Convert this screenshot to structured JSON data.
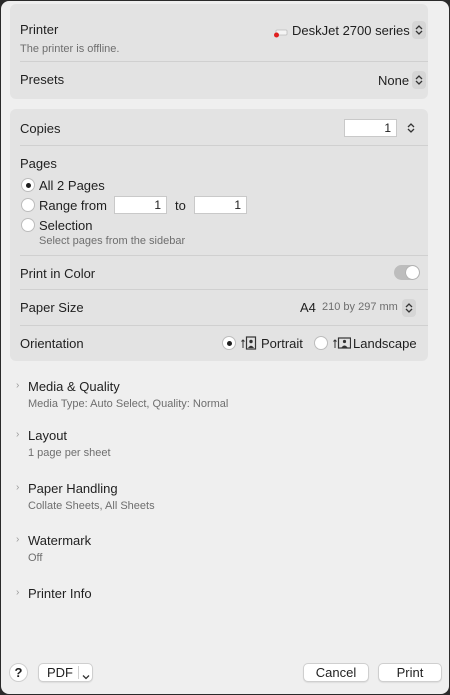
{
  "printer": {
    "label": "Printer",
    "name": "DeskJet 2700 series",
    "status": "The printer is offline."
  },
  "presets": {
    "label": "Presets",
    "value": "None"
  },
  "copies": {
    "label": "Copies",
    "value": "1"
  },
  "pages": {
    "label": "Pages",
    "all_label": "All 2 Pages",
    "range_label": "Range from",
    "range_from": "1",
    "to_label": "to",
    "range_to": "1",
    "selection_label": "Selection",
    "selection_hint": "Select pages from the sidebar",
    "selected": "all"
  },
  "color": {
    "label": "Print in Color",
    "enabled": false
  },
  "paper": {
    "label": "Paper Size",
    "size": "A4",
    "dimensions": "210 by 297 mm"
  },
  "orientation": {
    "label": "Orientation",
    "portrait": "Portrait",
    "landscape": "Landscape",
    "selected": "portrait"
  },
  "sections": [
    {
      "title": "Media & Quality",
      "summary": "Media Type: Auto Select, Quality: Normal"
    },
    {
      "title": "Layout",
      "summary": "1 page per sheet"
    },
    {
      "title": "Paper Handling",
      "summary": "Collate Sheets, All Sheets"
    },
    {
      "title": "Watermark",
      "summary": "Off"
    },
    {
      "title": "Printer Info",
      "summary": ""
    }
  ],
  "footer": {
    "help": "?",
    "pdf": "PDF",
    "cancel": "Cancel",
    "print": "Print"
  },
  "colors": {
    "window_bg": "#efefef",
    "card_bg": "#e3e3e3",
    "printer_status_dot": "#e02020"
  }
}
